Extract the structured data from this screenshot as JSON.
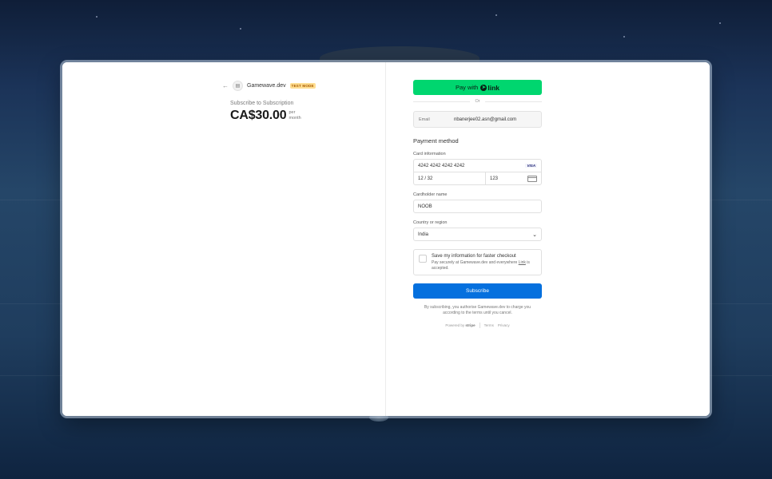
{
  "merchant": {
    "name": "Gamewave.dev",
    "mode_badge": "TEST MODE"
  },
  "product": {
    "title": "Subscribe to Subscription",
    "price": "CA$30.00",
    "period_line1": "per",
    "period_line2": "month"
  },
  "payment": {
    "link_button_prefix": "Pay with",
    "link_brand": "link",
    "or_text": "Or",
    "email_label": "Email",
    "email_value": "nbanerjee02.asn@gmail.com",
    "section_title": "Payment method",
    "card_label": "Card information",
    "card_number": "4242 4242 4242 4242",
    "card_brand": "VISA",
    "card_expiry": "12 / 32",
    "card_cvc": "123",
    "cardholder_label": "Cardholder name",
    "cardholder_value": "NOOB",
    "country_label": "Country or region",
    "country_value": "India",
    "save_title": "Save my information for faster checkout",
    "save_desc_part1": "Pay securely at Gamewave.dev and everywhere ",
    "save_desc_link": "Link",
    "save_desc_part2": " is accepted.",
    "subscribe_label": "Subscribe",
    "legal_text": "By subscribing, you authorise Gamewave.dev to charge you according to the terms until you cancel.",
    "powered_by": "Powered by",
    "stripe": "stripe",
    "terms": "Terms",
    "privacy": "Privacy"
  },
  "colors": {
    "link_green": "#00d66f",
    "subscribe_blue": "#0570de",
    "test_badge": "#ffde92"
  }
}
